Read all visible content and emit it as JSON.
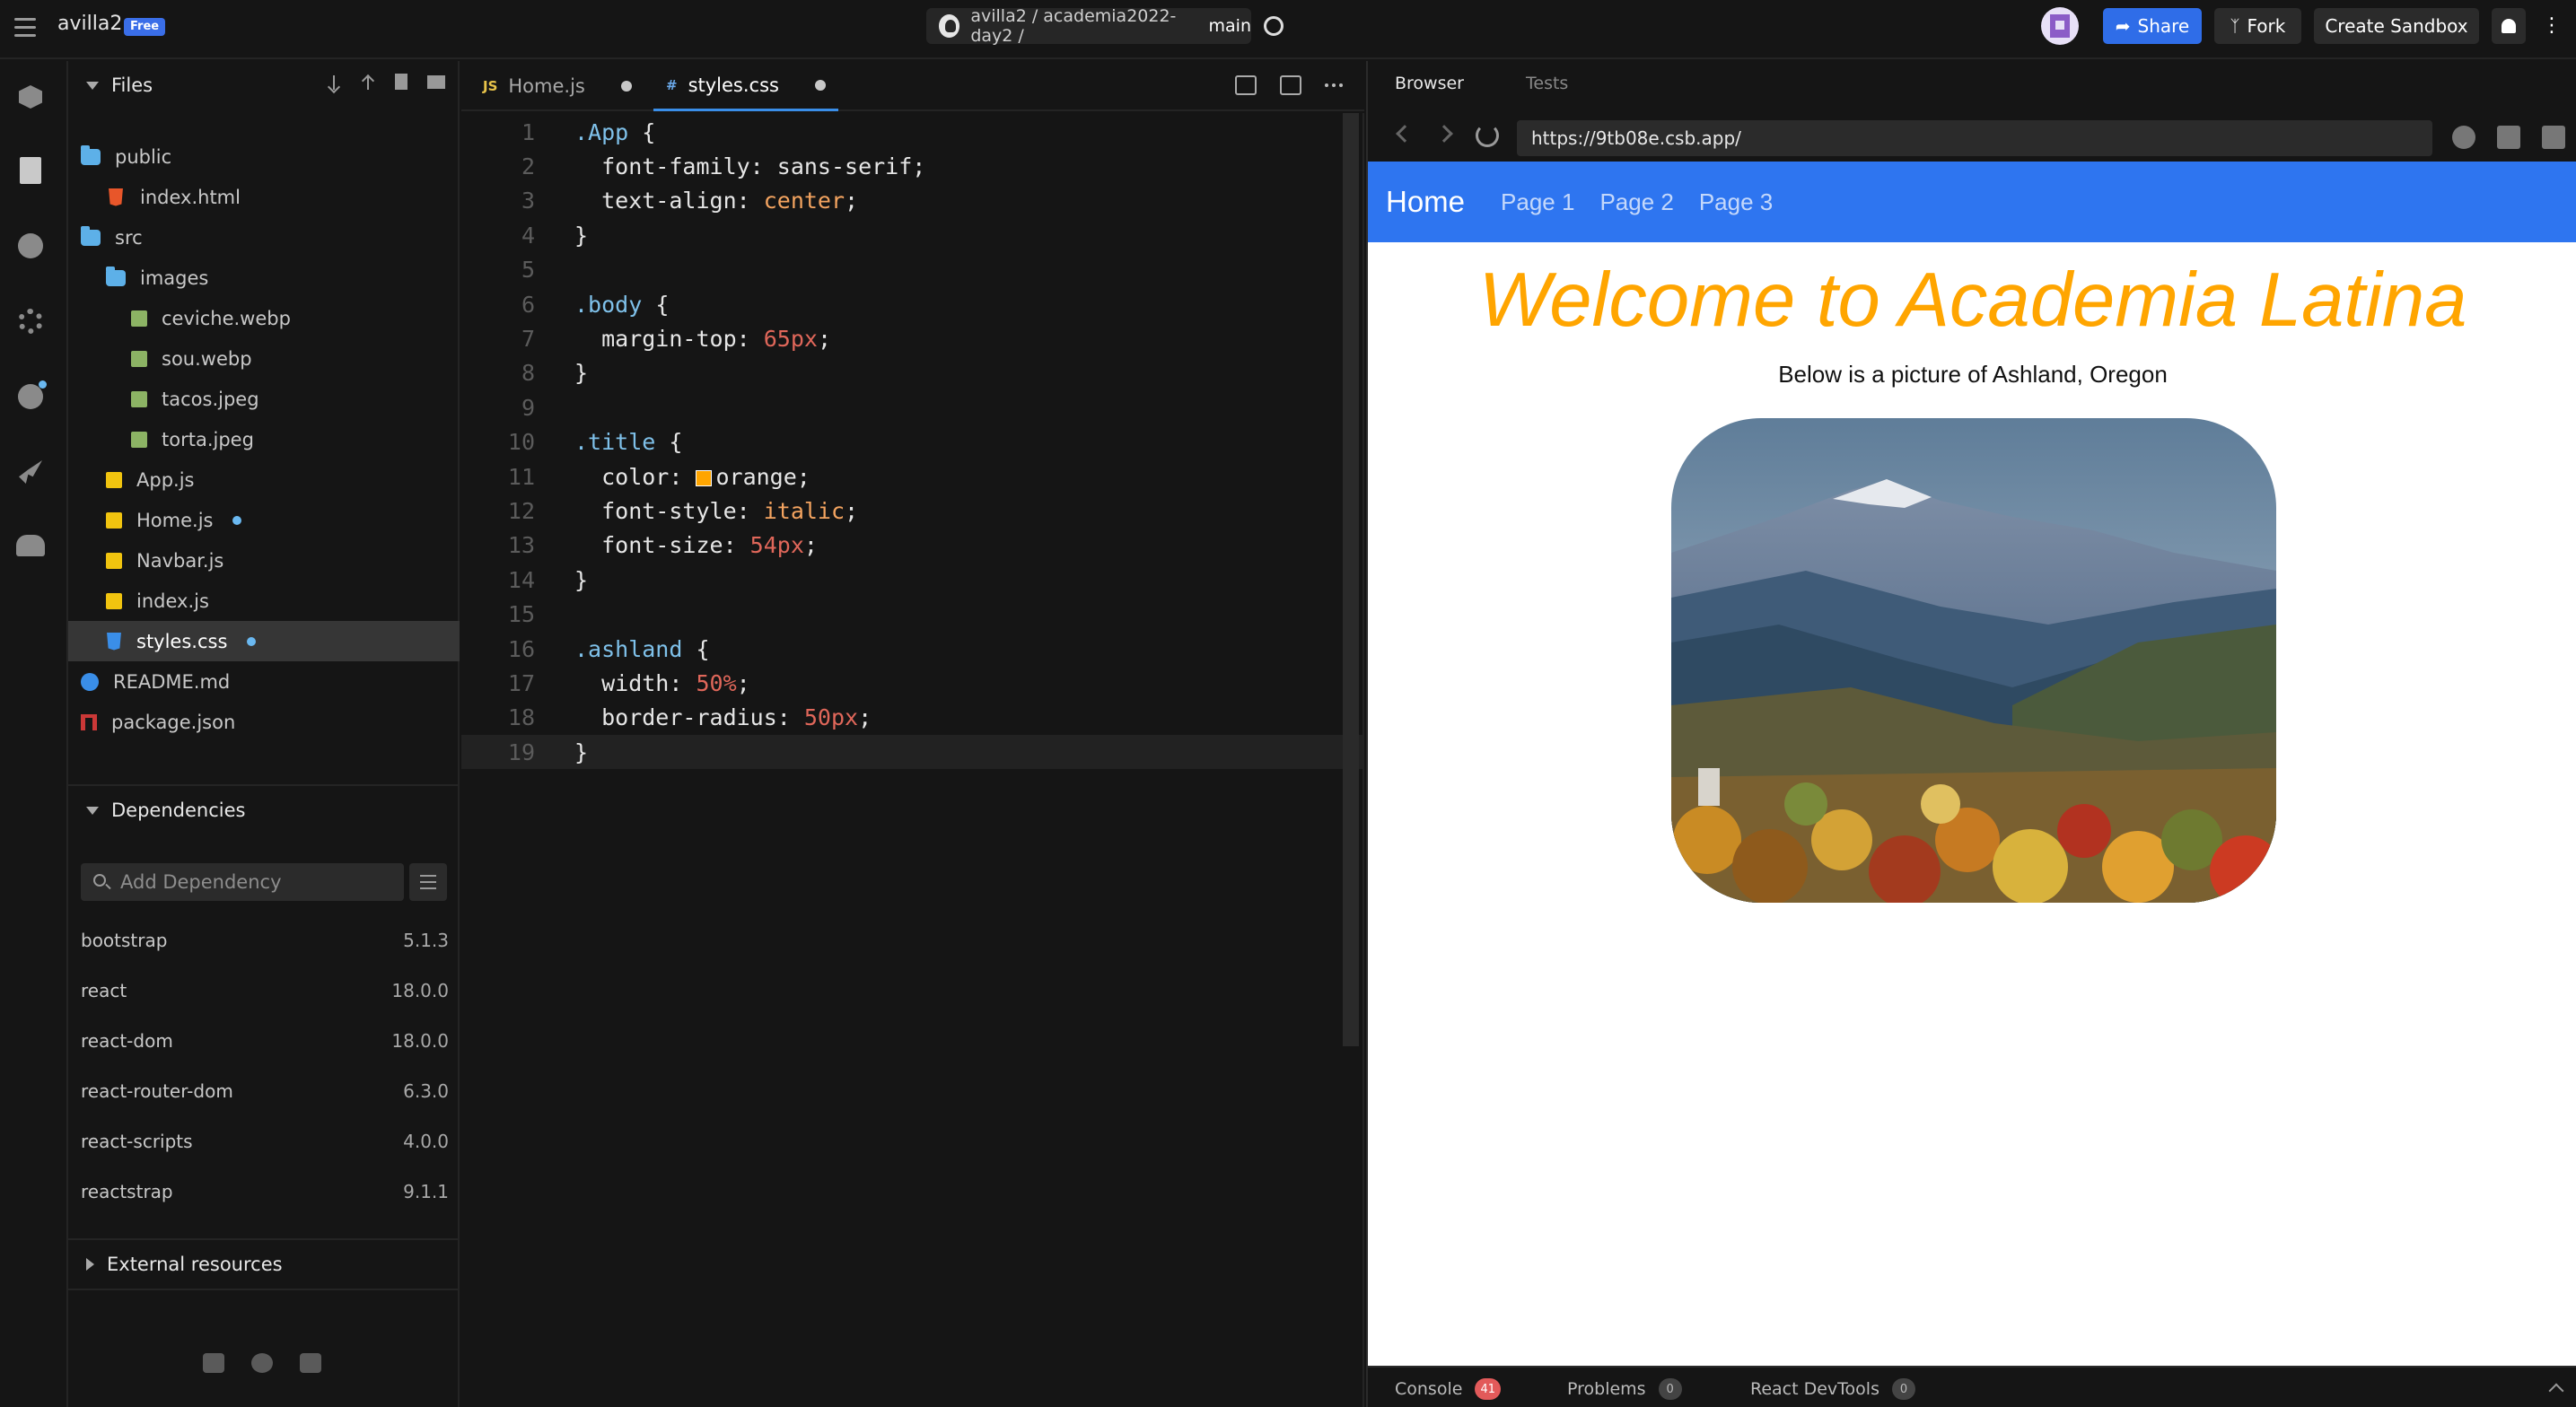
{
  "topbar": {
    "username": "avilla2",
    "plan": "Free",
    "repo_path": "avilla2 / academia2022-day2 / ",
    "repo_branch": "main",
    "share_label": "Share",
    "fork_label": "Fork",
    "create_label": "Create Sandbox"
  },
  "sidebar": {
    "files_title": "Files",
    "tree": [
      {
        "name": "public",
        "type": "folder",
        "depth": 0
      },
      {
        "name": "index.html",
        "type": "html",
        "depth": 1
      },
      {
        "name": "src",
        "type": "folder",
        "depth": 0
      },
      {
        "name": "images",
        "type": "folder",
        "depth": 1
      },
      {
        "name": "ceviche.webp",
        "type": "img",
        "depth": 2
      },
      {
        "name": "sou.webp",
        "type": "img",
        "depth": 2
      },
      {
        "name": "tacos.jpeg",
        "type": "img",
        "depth": 2
      },
      {
        "name": "torta.jpeg",
        "type": "img",
        "depth": 2
      },
      {
        "name": "App.js",
        "type": "js",
        "depth": 1
      },
      {
        "name": "Home.js",
        "type": "js",
        "depth": 1,
        "modified": true
      },
      {
        "name": "Navbar.js",
        "type": "js",
        "depth": 1
      },
      {
        "name": "index.js",
        "type": "js",
        "depth": 1
      },
      {
        "name": "styles.css",
        "type": "css",
        "depth": 1,
        "modified": true,
        "selected": true
      },
      {
        "name": "README.md",
        "type": "info",
        "depth": 0
      },
      {
        "name": "package.json",
        "type": "npm",
        "depth": 0
      }
    ],
    "dependencies_title": "Dependencies",
    "dep_placeholder": "Add Dependency",
    "dependencies": [
      {
        "name": "bootstrap",
        "version": "5.1.3"
      },
      {
        "name": "react",
        "version": "18.0.0"
      },
      {
        "name": "react-dom",
        "version": "18.0.0"
      },
      {
        "name": "react-router-dom",
        "version": "6.3.0"
      },
      {
        "name": "react-scripts",
        "version": "4.0.0"
      },
      {
        "name": "reactstrap",
        "version": "9.1.1"
      }
    ],
    "external_title": "External resources"
  },
  "editor": {
    "tabs": [
      {
        "lang": "JS",
        "label": "Home.js",
        "modified": true
      },
      {
        "lang": "#",
        "label": "styles.css",
        "modified": true,
        "active": true
      }
    ],
    "lines": [
      [
        {
          "t": ".App",
          "c": "sel"
        },
        {
          "t": " {"
        }
      ],
      [
        {
          "t": "  font-family: sans-serif;"
        }
      ],
      [
        {
          "t": "  text-align: "
        },
        {
          "t": "center",
          "c": "val"
        },
        {
          "t": ";"
        }
      ],
      [
        {
          "t": "}"
        }
      ],
      [],
      [
        {
          "t": ".body",
          "c": "sel"
        },
        {
          "t": " {"
        }
      ],
      [
        {
          "t": "  margin-top: "
        },
        {
          "t": "65px",
          "c": "num"
        },
        {
          "t": ";"
        }
      ],
      [
        {
          "t": "}"
        }
      ],
      [],
      [
        {
          "t": ".title",
          "c": "sel"
        },
        {
          "t": " {"
        }
      ],
      [
        {
          "t": "  color: "
        },
        {
          "t": "",
          "c": "swatch"
        },
        {
          "t": "orange;"
        }
      ],
      [
        {
          "t": "  font-style: "
        },
        {
          "t": "italic",
          "c": "val"
        },
        {
          "t": ";"
        }
      ],
      [
        {
          "t": "  font-size: "
        },
        {
          "t": "54px",
          "c": "num"
        },
        {
          "t": ";"
        }
      ],
      [
        {
          "t": "}"
        }
      ],
      [],
      [
        {
          "t": ".ashland",
          "c": "sel"
        },
        {
          "t": " {"
        }
      ],
      [
        {
          "t": "  width: "
        },
        {
          "t": "50%",
          "c": "num"
        },
        {
          "t": ";"
        }
      ],
      [
        {
          "t": "  border-radius: "
        },
        {
          "t": "50px",
          "c": "num"
        },
        {
          "t": ";"
        }
      ],
      [
        {
          "t": "}"
        }
      ]
    ],
    "active_line": 19
  },
  "preview": {
    "tabs": [
      "Browser",
      "Tests"
    ],
    "url": "https://9tb08e.csb.app/",
    "nav": {
      "brand": "Home",
      "links": [
        "Page 1",
        "Page 2",
        "Page 3"
      ]
    },
    "heading": "Welcome to Academia Latina",
    "caption": "Below is a picture of Ashland, Oregon",
    "bottom_tabs": [
      {
        "label": "Console",
        "count": "41"
      },
      {
        "label": "Problems",
        "count": "0"
      },
      {
        "label": "React DevTools",
        "count": "0"
      }
    ]
  },
  "colors": {
    "accent": "#2f6de8",
    "app_nav": "#2e75f0",
    "title_orange": "#ffa500"
  }
}
